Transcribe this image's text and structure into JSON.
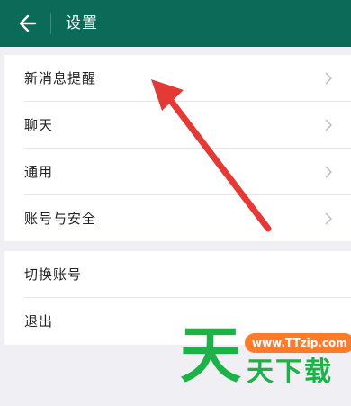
{
  "header": {
    "back_icon": "arrow-left-icon",
    "title": "设置",
    "background_color": "#0b6b58"
  },
  "settings_group_1": {
    "items": [
      {
        "label": "新消息提醒",
        "icon": "chevron-right-icon"
      },
      {
        "label": "聊天",
        "icon": "chevron-right-icon"
      },
      {
        "label": "通用",
        "icon": "chevron-right-icon"
      },
      {
        "label": "账号与安全",
        "icon": "chevron-right-icon"
      }
    ]
  },
  "settings_group_2": {
    "items": [
      {
        "label": "切换账号"
      },
      {
        "label": "退出"
      }
    ]
  },
  "annotation": {
    "arrow_color": "#e53935"
  },
  "watermark": {
    "big_char": "天",
    "url": "www.TTzip.com",
    "small_text": "天下载",
    "green_color": "#1db248",
    "orange_color": "#ff7a2a"
  }
}
